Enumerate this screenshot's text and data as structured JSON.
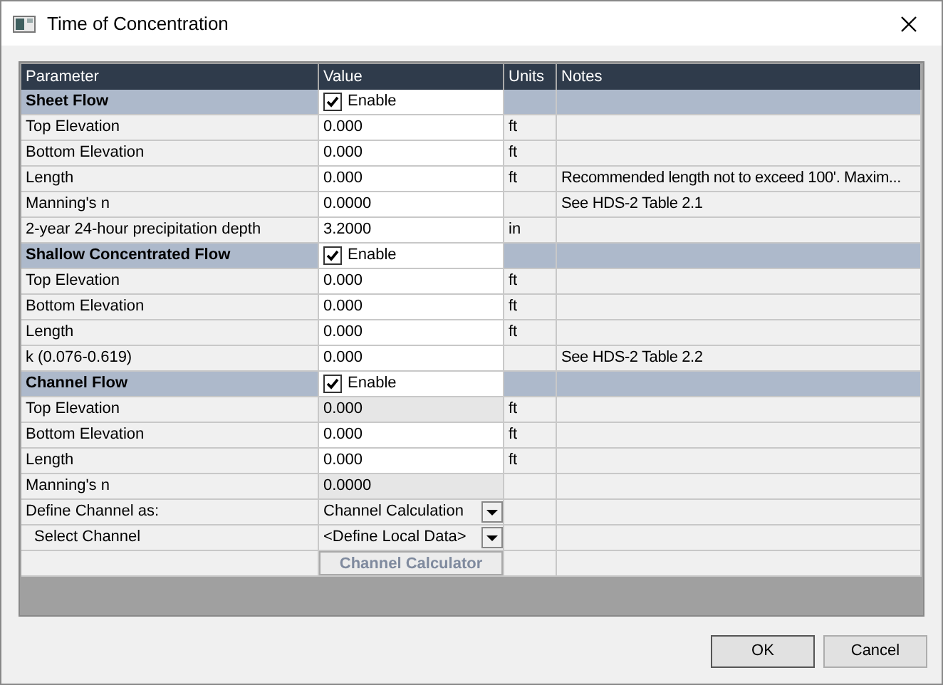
{
  "window": {
    "title": "Time of Concentration"
  },
  "table": {
    "columns": [
      "Parameter",
      "Value",
      "Units",
      "Notes"
    ],
    "rows": [
      {
        "kind": "section",
        "parameter": "Sheet Flow",
        "value": "Enable",
        "checked": true
      },
      {
        "kind": "value",
        "parameter": "Top Elevation",
        "value": "0.000",
        "units": "ft",
        "editable": true
      },
      {
        "kind": "value",
        "parameter": "Bottom Elevation",
        "value": "0.000",
        "units": "ft",
        "editable": true
      },
      {
        "kind": "value",
        "parameter": "Length",
        "value": "0.000",
        "units": "ft",
        "notes": "Recommended length not to exceed 100'.  Maxim...",
        "editable": true
      },
      {
        "kind": "value",
        "parameter": "Manning's n",
        "value": "0.0000",
        "notes": "See HDS-2 Table 2.1",
        "editable": true
      },
      {
        "kind": "value",
        "parameter": "2-year 24-hour precipitation depth",
        "value": "3.2000",
        "units": "in",
        "editable": true
      },
      {
        "kind": "section",
        "parameter": "Shallow Concentrated Flow",
        "value": "Enable",
        "checked": true
      },
      {
        "kind": "value",
        "parameter": "Top Elevation",
        "value": "0.000",
        "units": "ft",
        "editable": true
      },
      {
        "kind": "value",
        "parameter": "Bottom Elevation",
        "value": "0.000",
        "units": "ft",
        "editable": true
      },
      {
        "kind": "value",
        "parameter": "Length",
        "value": "0.000",
        "units": "ft",
        "editable": true
      },
      {
        "kind": "value",
        "parameter": "k (0.076-0.619)",
        "value": "0.000",
        "notes": "See HDS-2 Table 2.2",
        "editable": true
      },
      {
        "kind": "section",
        "parameter": "Channel Flow",
        "value": "Enable",
        "checked": true
      },
      {
        "kind": "value",
        "parameter": "Top Elevation",
        "value": "0.000",
        "units": "ft",
        "editable": false
      },
      {
        "kind": "value",
        "parameter": "Bottom Elevation",
        "value": "0.000",
        "units": "ft",
        "editable": true
      },
      {
        "kind": "value",
        "parameter": "Length",
        "value": "0.000",
        "units": "ft",
        "editable": true
      },
      {
        "kind": "value",
        "parameter": "Manning's n",
        "value": "0.0000",
        "editable": false
      },
      {
        "kind": "dropdown",
        "parameter": "Define Channel as:",
        "value": "Channel Calculation",
        "children": [
          {
            "kind": "dropdown",
            "parameter": "Select Channel",
            "value": "<Define Local Data>"
          }
        ]
      },
      {
        "kind": "button",
        "value": "Channel Calculator",
        "disabled": true
      }
    ]
  },
  "buttons": [
    "OK",
    "Cancel"
  ]
}
